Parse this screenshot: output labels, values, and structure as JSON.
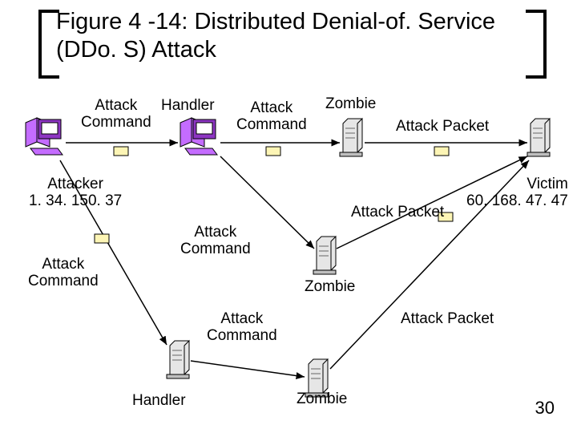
{
  "title": "Figure 4 -14: Distributed Denial-of. Service (DDo. S) Attack",
  "labels": {
    "attackCommand1": "Attack\nCommand",
    "handlerTop": "Handler",
    "attackCommand2": "Attack\nCommand",
    "zombieTop": "Zombie",
    "attackPacket1": "Attack Packet",
    "attacker": "Attacker\n1. 34. 150. 37",
    "attackCommand3": "Attack\nCommand",
    "attackPacket2": "Attack Packet",
    "victim": "Victim\n60. 168. 47. 47",
    "attackCommand4": "Attack\nCommand",
    "zombieMid": "Zombie",
    "attackCommand5": "Attack\nCommand",
    "attackPacket3": "Attack Packet",
    "handlerBottom": "Handler",
    "zombieBottom": "Zombie"
  },
  "pageNumber": "30"
}
